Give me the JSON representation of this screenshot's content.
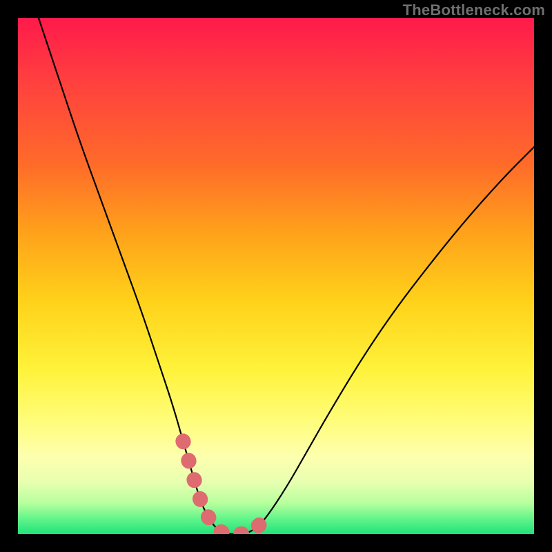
{
  "watermark": "TheBottleneck.com",
  "chart_data": {
    "type": "line",
    "title": "",
    "xlabel": "",
    "ylabel": "",
    "xlim": [
      0,
      100
    ],
    "ylim": [
      0,
      100
    ],
    "x": [
      4,
      8,
      12,
      16,
      20,
      24,
      27,
      30,
      32,
      34,
      35.5,
      37,
      38.5,
      40,
      42,
      44,
      46,
      48,
      52,
      56,
      60,
      66,
      72,
      78,
      86,
      94,
      100
    ],
    "values": [
      100,
      88,
      76,
      65,
      54,
      43,
      34,
      25,
      18,
      11,
      6,
      3,
      1,
      0,
      0,
      0,
      1,
      3,
      9,
      16,
      23,
      33,
      42,
      50,
      60,
      69,
      75
    ],
    "series": [
      {
        "name": "bottleneck-curve",
        "x": [
          4,
          8,
          12,
          16,
          20,
          24,
          27,
          30,
          32,
          34,
          35.5,
          37,
          38.5,
          40,
          42,
          44,
          46,
          48,
          52,
          56,
          60,
          66,
          72,
          78,
          86,
          94,
          100
        ],
        "y": [
          100,
          88,
          76,
          65,
          54,
          43,
          34,
          25,
          18,
          11,
          6,
          3,
          1,
          0,
          0,
          0,
          1,
          3,
          9,
          16,
          23,
          33,
          42,
          50,
          60,
          69,
          75
        ]
      }
    ],
    "highlight_segment": {
      "description": "thick pink stroke near trough",
      "x": [
        32,
        34,
        35.5,
        37,
        38.5,
        40,
        42,
        44,
        46,
        48
      ],
      "y": [
        18,
        11,
        6,
        3,
        1,
        0,
        0,
        0,
        1,
        3
      ]
    },
    "gradient_stops": [
      {
        "pos": 0,
        "color": "#ff1a4b"
      },
      {
        "pos": 12,
        "color": "#ff3f3f"
      },
      {
        "pos": 28,
        "color": "#ff6a2a"
      },
      {
        "pos": 42,
        "color": "#ffa31a"
      },
      {
        "pos": 55,
        "color": "#ffd21a"
      },
      {
        "pos": 68,
        "color": "#fff23a"
      },
      {
        "pos": 78,
        "color": "#fffd7a"
      },
      {
        "pos": 85,
        "color": "#fdffae"
      },
      {
        "pos": 90,
        "color": "#e7ffb0"
      },
      {
        "pos": 94,
        "color": "#b7ff9e"
      },
      {
        "pos": 97,
        "color": "#63f58a"
      },
      {
        "pos": 100,
        "color": "#1fe27a"
      }
    ],
    "highlight_color": "#dd6b6f"
  }
}
